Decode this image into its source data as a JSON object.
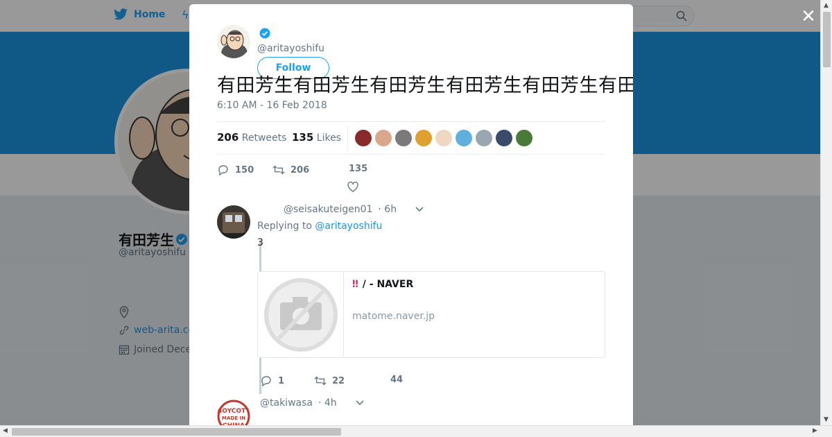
{
  "nav": {
    "home_label": "Home"
  },
  "background_profile": {
    "name": "有田芳生",
    "handle": "@aritayoshifu",
    "link": "web-arita.co",
    "joined": "Joined Dece"
  },
  "tweet": {
    "handle": "@aritayoshifu",
    "follow_label": "Follow",
    "text": "有田芳生有田芳生有田芳生有田芳生有田芳生有田芳生有田芳生有田芳生有田芳生有田芳生有田芳生有田芳生有田芳生有田芳生有田芳",
    "timestamp": "6:10 AM - 16 Feb 2018",
    "retweets_count": "206",
    "retweets_label": "Retweets",
    "likes_count": "135",
    "likes_label": "Likes",
    "actions": {
      "replies": "150",
      "retweets": "206",
      "likes": "135"
    }
  },
  "likers": [
    "#8a2b2b",
    "#d9a88a",
    "#7a7a7a",
    "#e0a030",
    "#f0d8c0",
    "#5fb0e0",
    "#9aa6b0",
    "#3a4a6a",
    "#4a7a3a"
  ],
  "replies": [
    {
      "handle": "@seisakuteigen01",
      "time": "· 6h",
      "replying_prefix": "Replying to",
      "replying_to": "@aritayoshifu",
      "text": "3",
      "card": {
        "title_mark": "‼",
        "title": "/ - NAVER",
        "domain": "matome.naver.jp"
      },
      "actions": {
        "replies": "1",
        "retweets": "22",
        "likes": "44"
      }
    },
    {
      "handle": "@takiwasa",
      "time": "· 4h",
      "avatar_text": "BOYCOTT MADE IN CHINA"
    }
  ],
  "colors": {
    "accent": "#1da1f2",
    "link": "#1b95e0",
    "banner": "#1b95e0"
  }
}
